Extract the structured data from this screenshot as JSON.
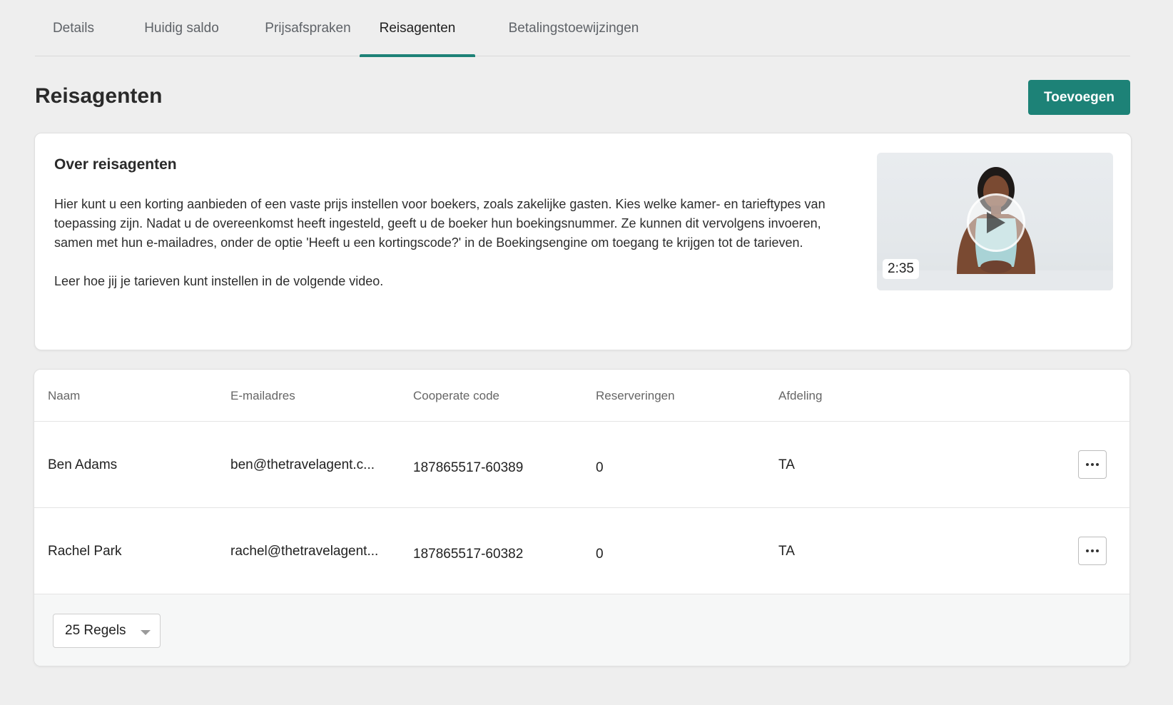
{
  "tabs": [
    {
      "label": "Details"
    },
    {
      "label": "Huidig saldo"
    },
    {
      "label": "Prijsafspraken"
    },
    {
      "label": "Reisagenten",
      "active": true
    },
    {
      "label": "Betalingstoewijzingen"
    }
  ],
  "page": {
    "title": "Reisagenten",
    "add_button": "Toevoegen"
  },
  "info": {
    "title": "Over reisagenten",
    "paragraph1": "Hier kunt u een korting aanbieden of een vaste prijs instellen voor boekers, zoals zakelijke gasten. Kies welke kamer- en tarieftypes van toepassing zijn. Nadat u de overeenkomst heeft ingesteld, geeft u de boeker hun boekingsnummer. Ze kunnen dit vervolgens invoeren, samen met hun e-mailadres, onder de optie 'Heeft u een kortingscode?' in de Boekingsengine om toegang te krijgen tot de tarieven.",
    "paragraph2": "Leer hoe jij je tarieven kunt instellen in de volgende video.",
    "video_duration": "2:35"
  },
  "table": {
    "headers": [
      "Naam",
      "E-mailadres",
      "Cooperate code",
      "Reserveringen",
      "Afdeling"
    ],
    "rows": [
      {
        "name": "Ben Adams",
        "email": "ben@thetravelagent.c...",
        "code": "187865517-60389",
        "reservations": "0",
        "department": "TA"
      },
      {
        "name": "Rachel Park",
        "email": "rachel@thetravelagent...",
        "code": "187865517-60382",
        "reservations": "0",
        "department": "TA"
      }
    ],
    "rows_per_page": "25 Regels"
  },
  "colors": {
    "accent": "#1d8277",
    "background": "#eeeeee"
  },
  "icons": {
    "row_actions": "more-horizontal-icon",
    "video": "play-icon",
    "select": "caret-down-icon"
  }
}
